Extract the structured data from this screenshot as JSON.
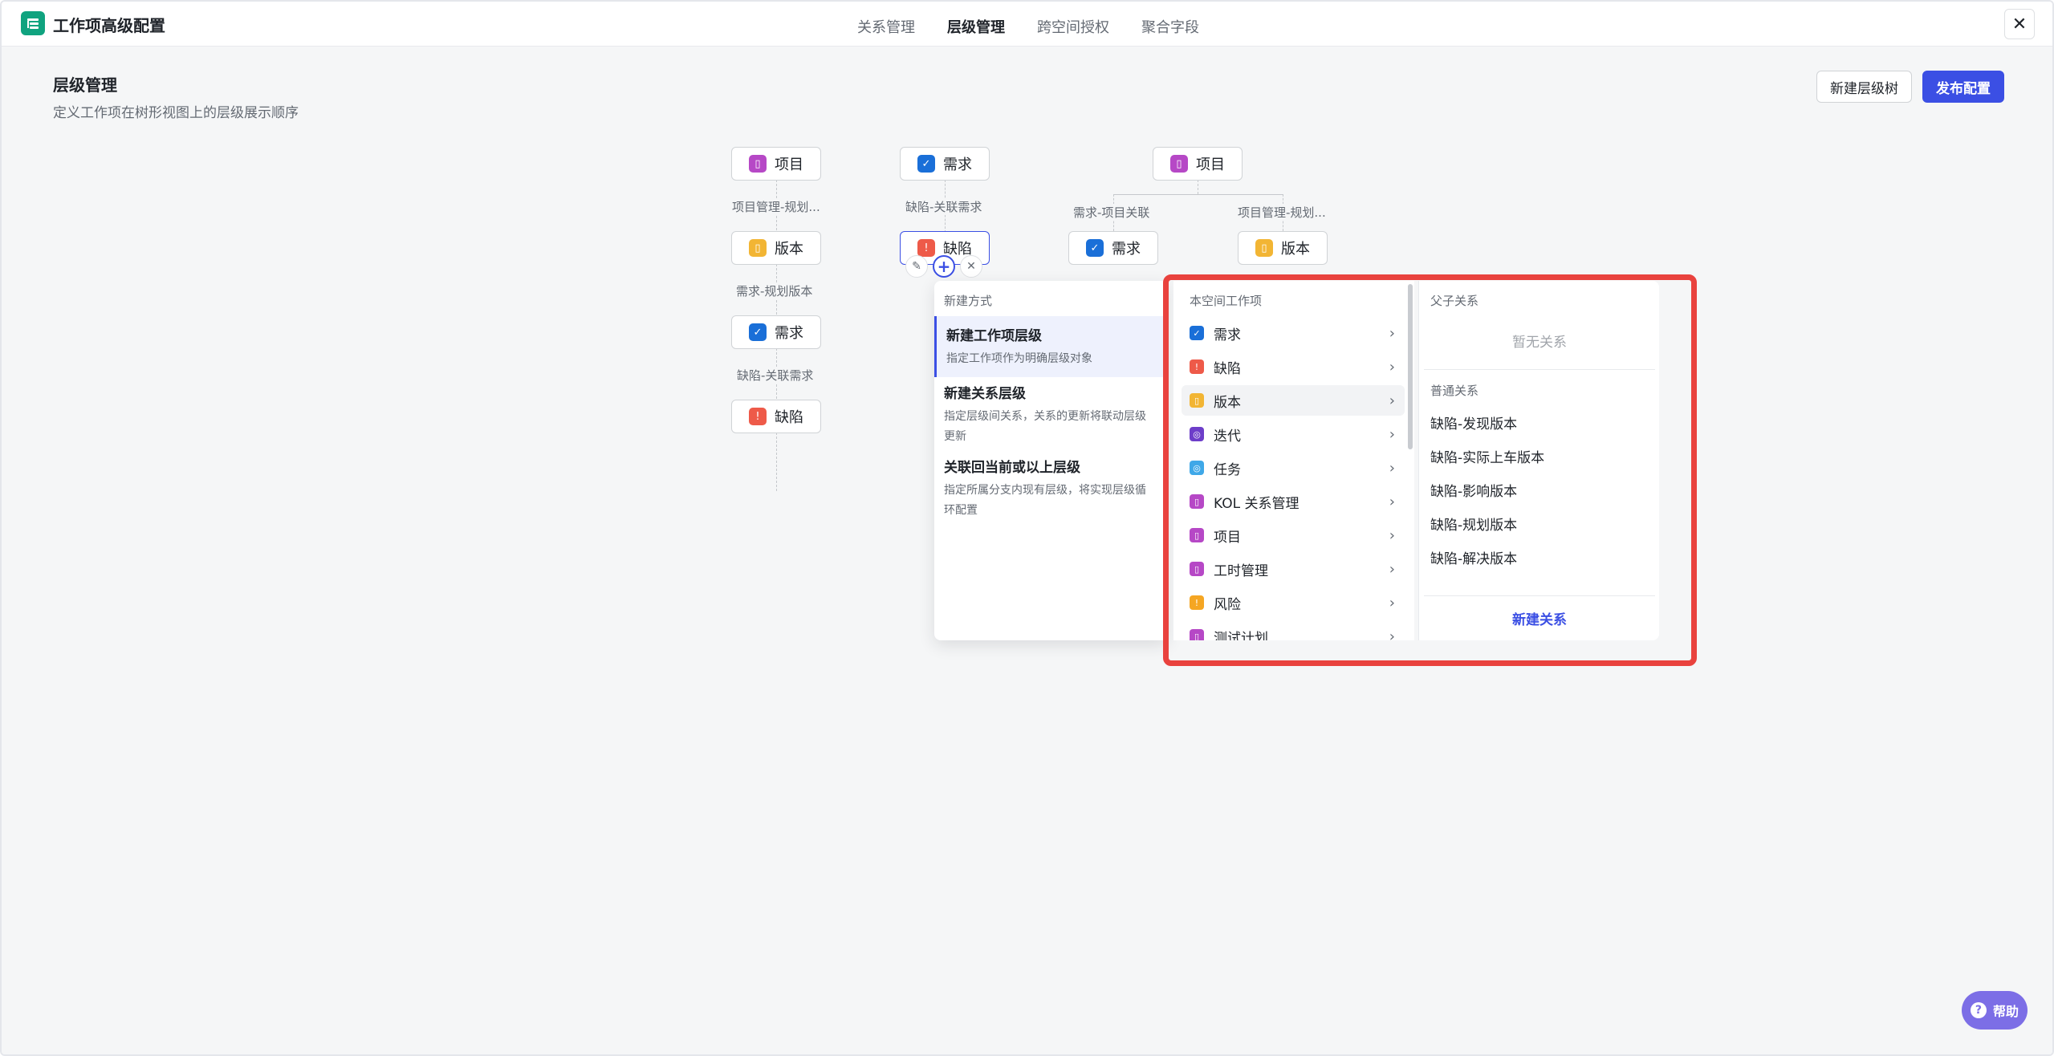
{
  "header": {
    "app_title": "工作项高级配置",
    "tabs": [
      {
        "label": "关系管理"
      },
      {
        "label": "层级管理"
      },
      {
        "label": "跨空间授权"
      },
      {
        "label": "聚合字段"
      }
    ],
    "active_tab": "层级管理",
    "close_glyph": "✕"
  },
  "page": {
    "heading": "层级管理",
    "description": "定义工作项在树形视图上的层级展示顺序",
    "new_tree_button": "新建层级树",
    "publish_button": "发布配置"
  },
  "trees": {
    "tree1": {
      "nodes": [
        "项目",
        "版本",
        "需求",
        "缺陷"
      ],
      "edges": [
        "项目管理-规划...",
        "需求-规划版本",
        "缺陷-关联需求"
      ]
    },
    "tree2": {
      "nodes": [
        "需求",
        "缺陷"
      ],
      "edges": [
        "缺陷-关联需求"
      ]
    },
    "tree3": {
      "root": "项目",
      "children": [
        "需求",
        "版本"
      ],
      "edges": [
        "需求-项目关联",
        "项目管理-规划..."
      ]
    }
  },
  "popup": {
    "methods_title": "新建方式",
    "methods": [
      {
        "title": "新建工作项层级",
        "desc": [
          "指定工作项作为明确层级对象"
        ]
      },
      {
        "title": "新建关系层级",
        "desc": [
          "指定层级间关系，关系的更新将联动层级",
          "更新"
        ]
      },
      {
        "title": "关联回当前或以上层级",
        "desc": [
          "指定所属分支内现有层级，将实现层级循",
          "环配置"
        ]
      }
    ],
    "types_title": "本空间工作项",
    "types": [
      {
        "label": "需求",
        "icon": "requirement-icon"
      },
      {
        "label": "缺陷",
        "icon": "bug-icon"
      },
      {
        "label": "版本",
        "icon": "version-icon"
      },
      {
        "label": "迭代",
        "icon": "sprint-icon"
      },
      {
        "label": "任务",
        "icon": "task-icon"
      },
      {
        "label": "KOL 关系管理",
        "icon": "bookmark-icon"
      },
      {
        "label": "项目",
        "icon": "bookmark-icon"
      },
      {
        "label": "工时管理",
        "icon": "bookmark-icon"
      },
      {
        "label": "风险",
        "icon": "risk-icon"
      },
      {
        "label": "测试计划",
        "icon": "bookmark-icon"
      }
    ],
    "relations": {
      "parent_title": "父子关系",
      "parent_empty": "暂无关系",
      "normal_title": "普通关系",
      "items": [
        "缺陷-发现版本",
        "缺陷-实际上车版本",
        "缺陷-影响版本",
        "缺陷-规划版本",
        "缺陷-解决版本"
      ],
      "new_relation": "新建关系"
    }
  },
  "help": {
    "label": "帮助"
  },
  "colors": {
    "primary": "#3b4fe4",
    "highlight": "#e9423e",
    "purple": "#b648c6",
    "blue": "#1a6fd8",
    "yellow": "#f2b534",
    "red": "#ee5a49"
  }
}
